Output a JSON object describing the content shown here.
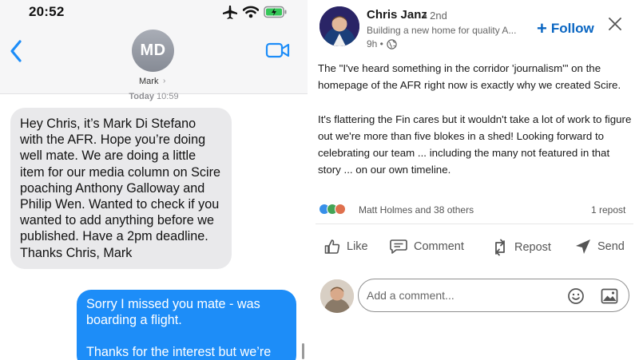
{
  "imessage": {
    "status_time": "20:52",
    "contact": {
      "initials": "MD",
      "name": "Mark"
    },
    "timestamp_day": "Today",
    "timestamp_time": "10:59",
    "incoming": "Hey Chris, it’s Mark Di Stefano with the AFR. Hope you’re doing well mate. We are doing a little item for our media column on Scire poaching Anthony Galloway and Philip Wen. Wanted to check if you wanted to add anything before we published. Have a 2pm deadline. Thanks Chris, Mark",
    "outgoing_line1": "Sorry I missed you mate - was boarding a flight.",
    "outgoing_line2": "Thanks for the interest but we’re"
  },
  "linkedin": {
    "author": "Chris Janz",
    "degree": "• 2nd",
    "headline": "Building a new home for quality A...",
    "time": "9h •",
    "follow_label": "Follow",
    "post_p1": "The \"I've heard something in the corridor 'journalism'\" on the homepage of the AFR right now is exactly why we created Scire.",
    "post_p2": "It's flattering the Fin cares but it wouldn't take a lot of work to figure out we're more than five blokes in a shed! Looking forward to celebrating our team ... including the many not featured in that story ... on our own timeline.",
    "reactions_text": "Matt Holmes and 38 others",
    "repost_count": "1 repost",
    "actions": {
      "like": "Like",
      "comment": "Comment",
      "repost": "Repost",
      "send": "Send"
    },
    "comment_placeholder": "Add a comment..."
  },
  "colors": {
    "imessage_blue": "#1d8df8",
    "incoming_gray": "#e9e9eb",
    "linkedin_blue": "#0a66c2"
  }
}
